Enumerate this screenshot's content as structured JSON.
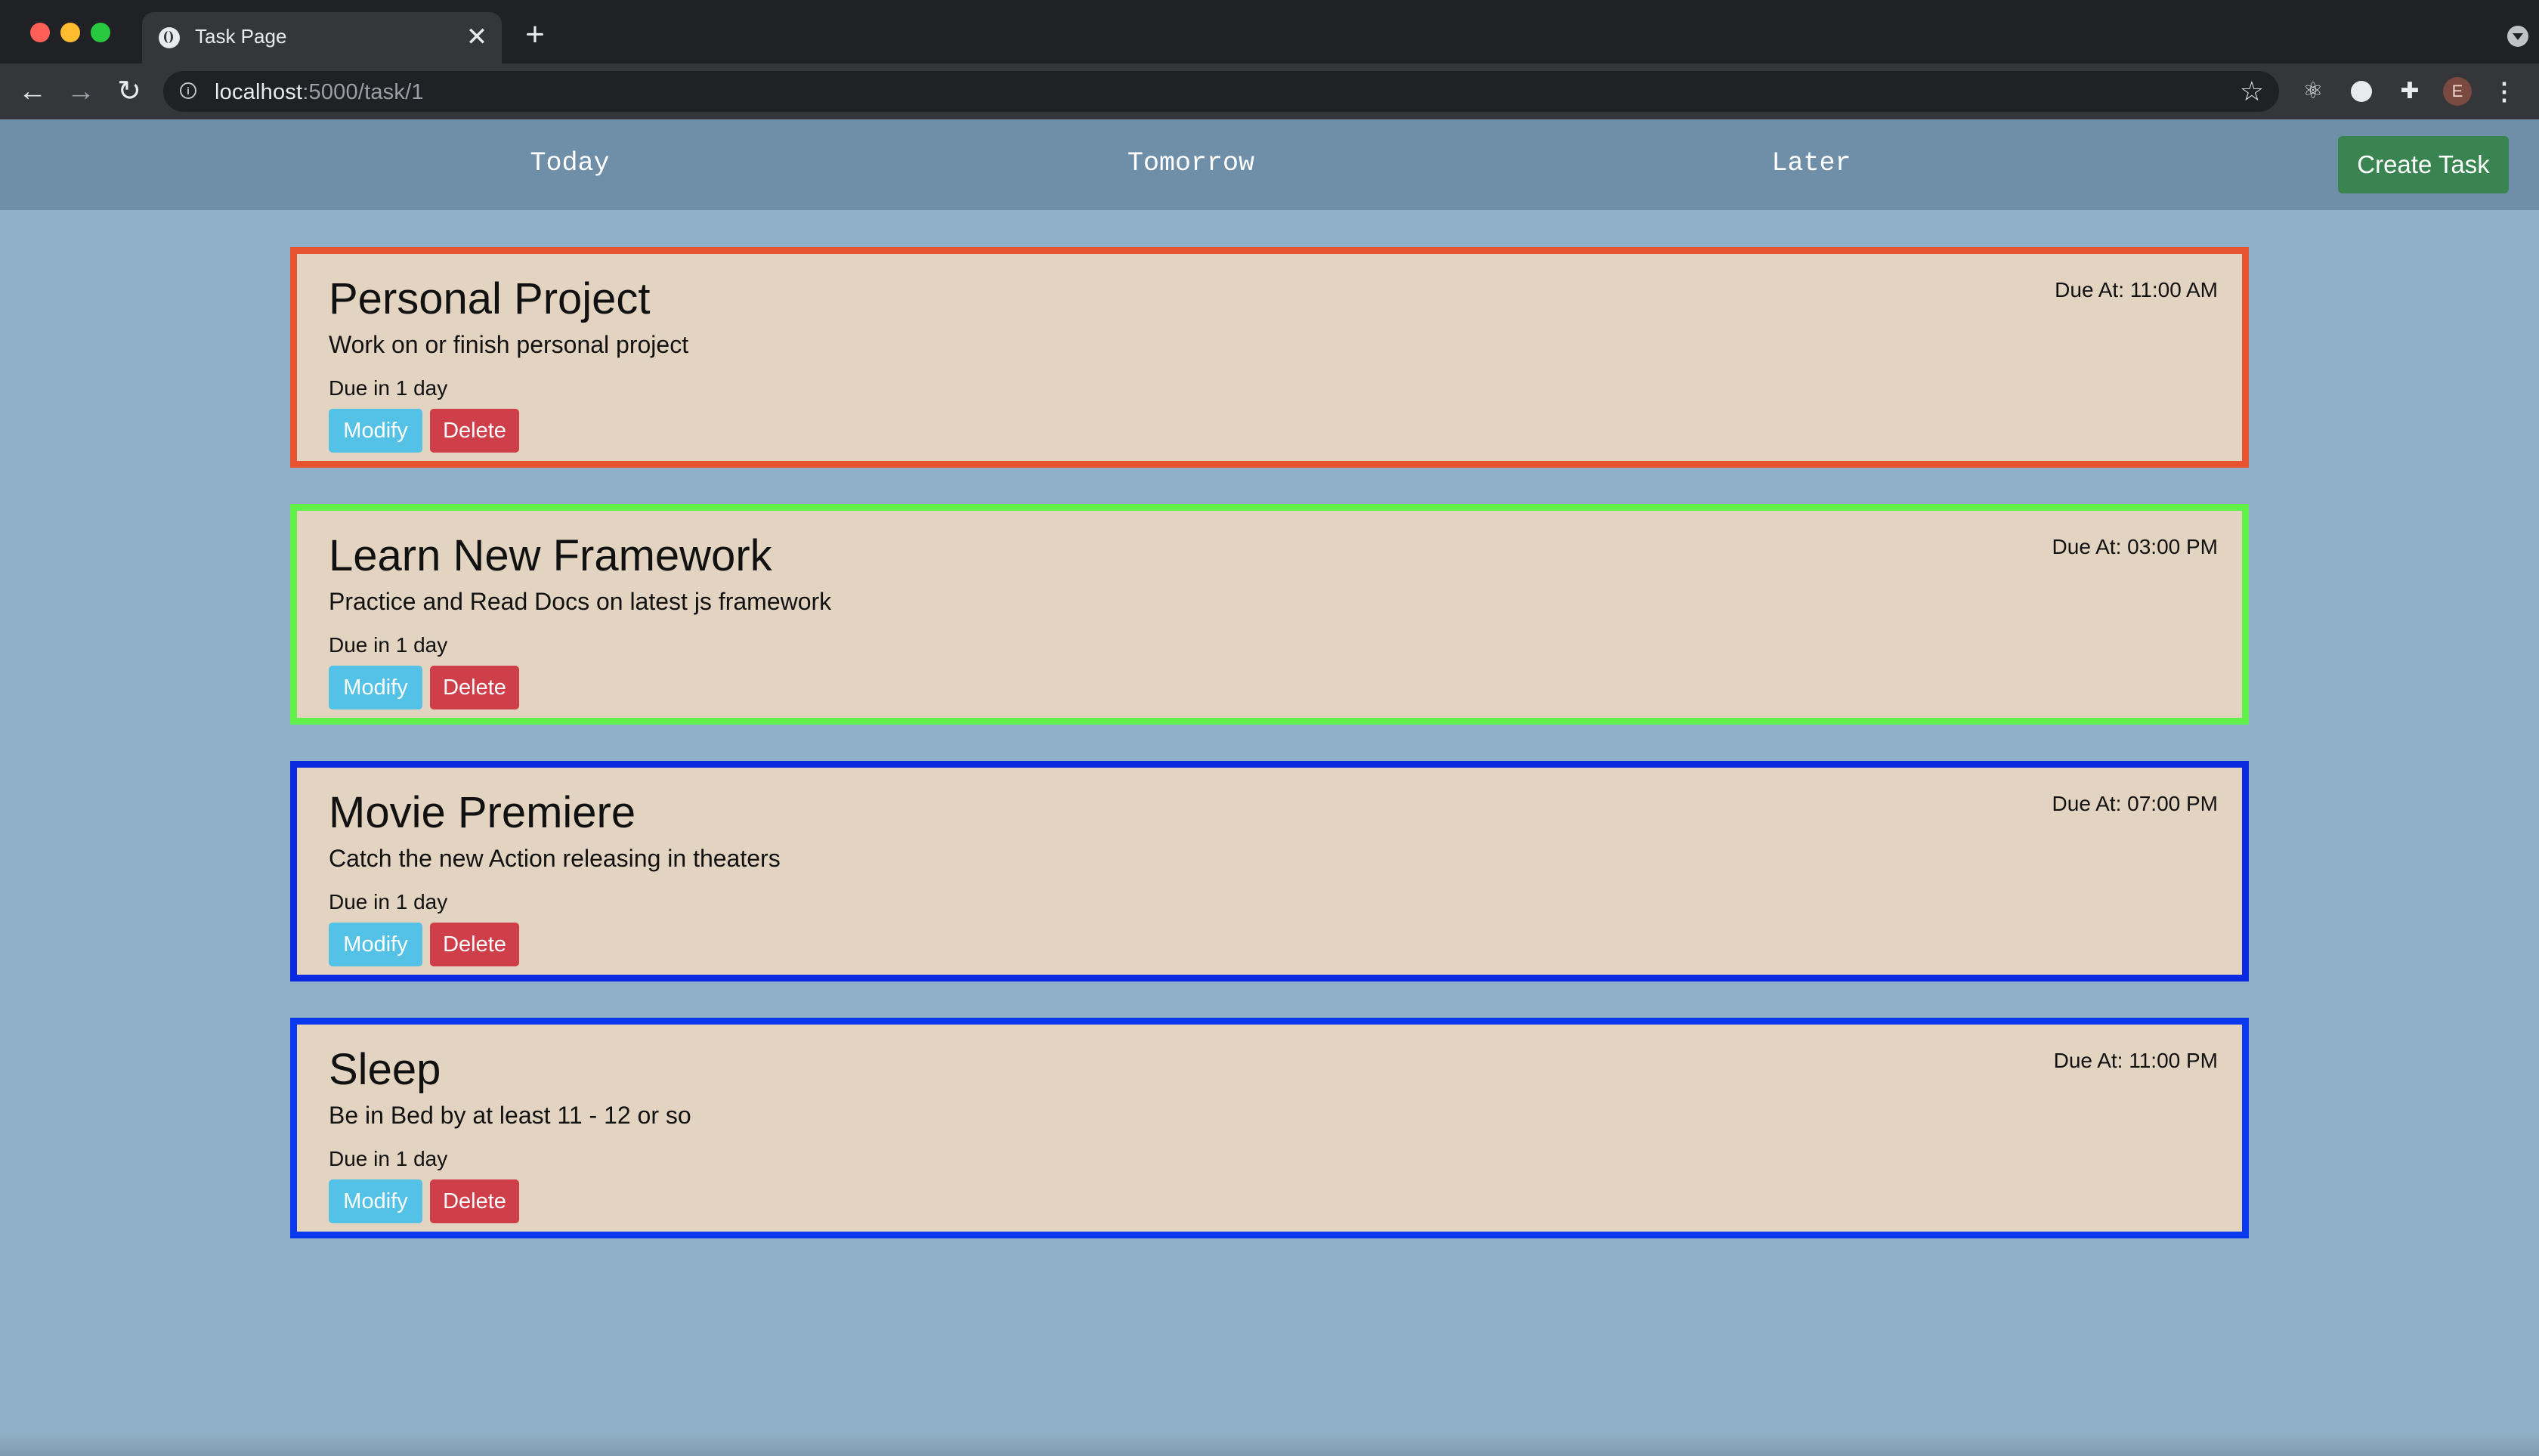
{
  "browser": {
    "tab_title": "Task Page",
    "tab_close": "✕",
    "new_tab": "+",
    "url_host": "localhost",
    "url_path": ":5000/task/1",
    "avatar_letter": "E",
    "icons": [
      "back-arrow-icon",
      "forward-arrow-icon",
      "reload-icon",
      "info-icon",
      "star-icon",
      "react-extension-icon",
      "circle-extension-icon",
      "puzzle-extension-icon",
      "kebab-menu-icon"
    ]
  },
  "nav": {
    "today": "Today",
    "tomorrow": "Tomorrow",
    "later": "Later",
    "create": "Create Task"
  },
  "tasks": [
    {
      "title": "Personal Project",
      "description": "Work on or finish personal project",
      "due_in": "Due in 1 day",
      "due_at": "Due At: 11:00 AM",
      "border_color": "#e8532f",
      "modify_label": "Modify",
      "delete_label": "Delete"
    },
    {
      "title": "Learn New Framework",
      "description": "Practice and Read Docs on latest js framework",
      "due_in": "Due in 1 day",
      "due_at": "Due At: 03:00 PM",
      "border_color": "#62f04a",
      "modify_label": "Modify",
      "delete_label": "Delete"
    },
    {
      "title": "Movie Premiere",
      "description": "Catch the new Action releasing in theaters",
      "due_in": "Due in 1 day",
      "due_at": "Due At: 07:00 PM",
      "border_color": "#0a2ae0",
      "modify_label": "Modify",
      "delete_label": "Delete"
    },
    {
      "title": "Sleep",
      "description": "Be in Bed by at least 11 - 12 or so",
      "due_in": "Due in 1 day",
      "due_at": "Due At: 11:00 PM",
      "border_color": "#0a3af0",
      "modify_label": "Modify",
      "delete_label": "Delete"
    }
  ],
  "colors": {
    "page_bg": "#8fb0c8",
    "navbar_bg": "#6f8fa8",
    "card_bg": "#e2d4c1",
    "modify_btn": "#54c1e6",
    "delete_btn": "#cf3f4a",
    "create_btn": "#3a8452"
  }
}
